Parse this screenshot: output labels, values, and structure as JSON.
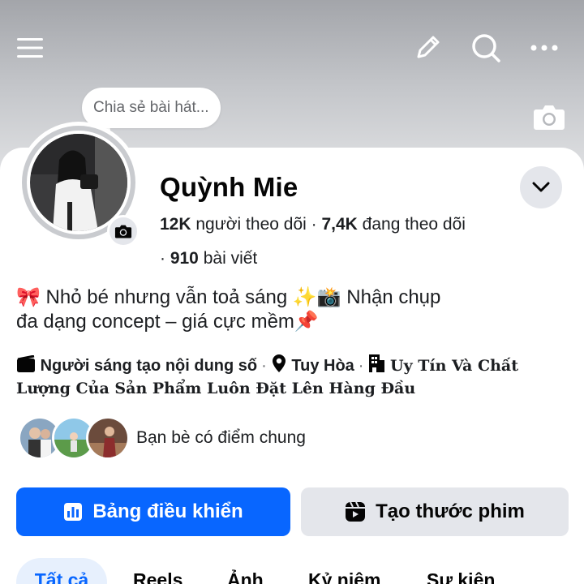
{
  "profile": {
    "name": "Quỳnh Mie",
    "followers_count": "12K",
    "followers_label": " người theo dõi",
    "following_count": "7,4K",
    "following_label": " đang theo dõi",
    "posts_count": "910",
    "posts_label": " bài viết",
    "bio_line1": "🎀 Nhỏ bé nhưng vẫn toả sáng ✨📸 Nhận chụp",
    "bio_line2": "đa dạng concept – giá cực mềm📌",
    "creator_label": "Người sáng tạo nội dung số",
    "location": "Tuy Hòa",
    "workplace": "Uy Tín Và Chất Lượng Của Sản Phẩm Luôn Đặt Lên Hàng Đầu",
    "song_placeholder": "Chia sẻ bài hát..."
  },
  "mutual_friends": {
    "label": "Bạn bè có điểm chung"
  },
  "actions": {
    "dashboard_label": "Bảng điều khiển",
    "create_reel_label": "Tạo thước phim"
  },
  "tabs": [
    {
      "label": "Tất cả",
      "active": true
    },
    {
      "label": "Reels",
      "active": false
    },
    {
      "label": "Ảnh",
      "active": false
    },
    {
      "label": "Kỷ niệm",
      "active": false
    },
    {
      "label": "Sự kiện",
      "active": false
    }
  ],
  "icons": {
    "menu": "hamburger-menu-icon",
    "edit": "pencil-icon",
    "search": "search-icon",
    "more": "more-dots-icon",
    "camera": "camera-icon",
    "dropdown": "chevron-down-icon"
  },
  "colors": {
    "accent": "#0866ff",
    "secondary_button": "#e4e6eb",
    "active_tab_bg": "#e7f0fd"
  }
}
